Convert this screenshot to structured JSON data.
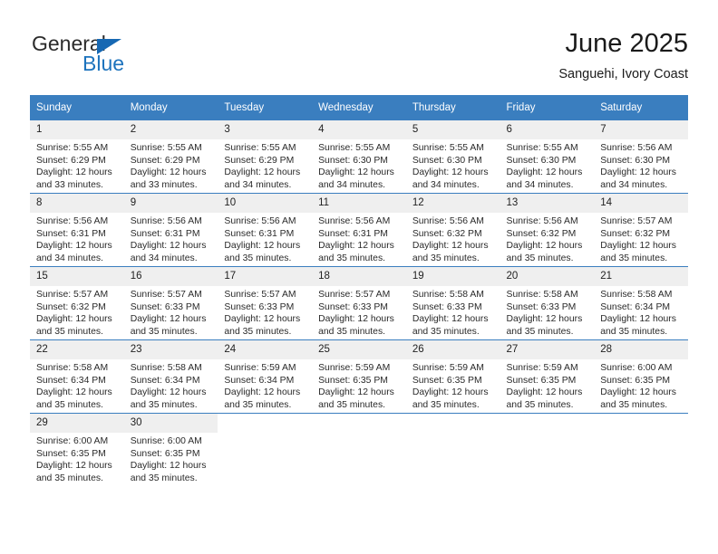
{
  "brand": {
    "name_top": "General",
    "name_bottom": "Blue",
    "triangle_icon": "blue-triangle-logo-icon",
    "color_blue": "#1d73bd",
    "color_dark": "#2b2b2b"
  },
  "header": {
    "month_title": "June 2025",
    "location": "Sanguehi, Ivory Coast"
  },
  "theme": {
    "header_blue": "#3a7ebf",
    "daynum_band": "#efefef",
    "separator": "#3a7ebf",
    "text": "#2a2a2a"
  },
  "weekdays": [
    "Sunday",
    "Monday",
    "Tuesday",
    "Wednesday",
    "Thursday",
    "Friday",
    "Saturday"
  ],
  "weeks": [
    [
      {
        "date": "1",
        "sunrise": "Sunrise: 5:55 AM",
        "sunset": "Sunset: 6:29 PM",
        "daylight": "Daylight: 12 hours and 33 minutes."
      },
      {
        "date": "2",
        "sunrise": "Sunrise: 5:55 AM",
        "sunset": "Sunset: 6:29 PM",
        "daylight": "Daylight: 12 hours and 33 minutes."
      },
      {
        "date": "3",
        "sunrise": "Sunrise: 5:55 AM",
        "sunset": "Sunset: 6:29 PM",
        "daylight": "Daylight: 12 hours and 34 minutes."
      },
      {
        "date": "4",
        "sunrise": "Sunrise: 5:55 AM",
        "sunset": "Sunset: 6:30 PM",
        "daylight": "Daylight: 12 hours and 34 minutes."
      },
      {
        "date": "5",
        "sunrise": "Sunrise: 5:55 AM",
        "sunset": "Sunset: 6:30 PM",
        "daylight": "Daylight: 12 hours and 34 minutes."
      },
      {
        "date": "6",
        "sunrise": "Sunrise: 5:55 AM",
        "sunset": "Sunset: 6:30 PM",
        "daylight": "Daylight: 12 hours and 34 minutes."
      },
      {
        "date": "7",
        "sunrise": "Sunrise: 5:56 AM",
        "sunset": "Sunset: 6:30 PM",
        "daylight": "Daylight: 12 hours and 34 minutes."
      }
    ],
    [
      {
        "date": "8",
        "sunrise": "Sunrise: 5:56 AM",
        "sunset": "Sunset: 6:31 PM",
        "daylight": "Daylight: 12 hours and 34 minutes."
      },
      {
        "date": "9",
        "sunrise": "Sunrise: 5:56 AM",
        "sunset": "Sunset: 6:31 PM",
        "daylight": "Daylight: 12 hours and 34 minutes."
      },
      {
        "date": "10",
        "sunrise": "Sunrise: 5:56 AM",
        "sunset": "Sunset: 6:31 PM",
        "daylight": "Daylight: 12 hours and 35 minutes."
      },
      {
        "date": "11",
        "sunrise": "Sunrise: 5:56 AM",
        "sunset": "Sunset: 6:31 PM",
        "daylight": "Daylight: 12 hours and 35 minutes."
      },
      {
        "date": "12",
        "sunrise": "Sunrise: 5:56 AM",
        "sunset": "Sunset: 6:32 PM",
        "daylight": "Daylight: 12 hours and 35 minutes."
      },
      {
        "date": "13",
        "sunrise": "Sunrise: 5:56 AM",
        "sunset": "Sunset: 6:32 PM",
        "daylight": "Daylight: 12 hours and 35 minutes."
      },
      {
        "date": "14",
        "sunrise": "Sunrise: 5:57 AM",
        "sunset": "Sunset: 6:32 PM",
        "daylight": "Daylight: 12 hours and 35 minutes."
      }
    ],
    [
      {
        "date": "15",
        "sunrise": "Sunrise: 5:57 AM",
        "sunset": "Sunset: 6:32 PM",
        "daylight": "Daylight: 12 hours and 35 minutes."
      },
      {
        "date": "16",
        "sunrise": "Sunrise: 5:57 AM",
        "sunset": "Sunset: 6:33 PM",
        "daylight": "Daylight: 12 hours and 35 minutes."
      },
      {
        "date": "17",
        "sunrise": "Sunrise: 5:57 AM",
        "sunset": "Sunset: 6:33 PM",
        "daylight": "Daylight: 12 hours and 35 minutes."
      },
      {
        "date": "18",
        "sunrise": "Sunrise: 5:57 AM",
        "sunset": "Sunset: 6:33 PM",
        "daylight": "Daylight: 12 hours and 35 minutes."
      },
      {
        "date": "19",
        "sunrise": "Sunrise: 5:58 AM",
        "sunset": "Sunset: 6:33 PM",
        "daylight": "Daylight: 12 hours and 35 minutes."
      },
      {
        "date": "20",
        "sunrise": "Sunrise: 5:58 AM",
        "sunset": "Sunset: 6:33 PM",
        "daylight": "Daylight: 12 hours and 35 minutes."
      },
      {
        "date": "21",
        "sunrise": "Sunrise: 5:58 AM",
        "sunset": "Sunset: 6:34 PM",
        "daylight": "Daylight: 12 hours and 35 minutes."
      }
    ],
    [
      {
        "date": "22",
        "sunrise": "Sunrise: 5:58 AM",
        "sunset": "Sunset: 6:34 PM",
        "daylight": "Daylight: 12 hours and 35 minutes."
      },
      {
        "date": "23",
        "sunrise": "Sunrise: 5:58 AM",
        "sunset": "Sunset: 6:34 PM",
        "daylight": "Daylight: 12 hours and 35 minutes."
      },
      {
        "date": "24",
        "sunrise": "Sunrise: 5:59 AM",
        "sunset": "Sunset: 6:34 PM",
        "daylight": "Daylight: 12 hours and 35 minutes."
      },
      {
        "date": "25",
        "sunrise": "Sunrise: 5:59 AM",
        "sunset": "Sunset: 6:35 PM",
        "daylight": "Daylight: 12 hours and 35 minutes."
      },
      {
        "date": "26",
        "sunrise": "Sunrise: 5:59 AM",
        "sunset": "Sunset: 6:35 PM",
        "daylight": "Daylight: 12 hours and 35 minutes."
      },
      {
        "date": "27",
        "sunrise": "Sunrise: 5:59 AM",
        "sunset": "Sunset: 6:35 PM",
        "daylight": "Daylight: 12 hours and 35 minutes."
      },
      {
        "date": "28",
        "sunrise": "Sunrise: 6:00 AM",
        "sunset": "Sunset: 6:35 PM",
        "daylight": "Daylight: 12 hours and 35 minutes."
      }
    ],
    [
      {
        "date": "29",
        "sunrise": "Sunrise: 6:00 AM",
        "sunset": "Sunset: 6:35 PM",
        "daylight": "Daylight: 12 hours and 35 minutes."
      },
      {
        "date": "30",
        "sunrise": "Sunrise: 6:00 AM",
        "sunset": "Sunset: 6:35 PM",
        "daylight": "Daylight: 12 hours and 35 minutes."
      },
      {
        "date": "",
        "sunrise": "",
        "sunset": "",
        "daylight": ""
      },
      {
        "date": "",
        "sunrise": "",
        "sunset": "",
        "daylight": ""
      },
      {
        "date": "",
        "sunrise": "",
        "sunset": "",
        "daylight": ""
      },
      {
        "date": "",
        "sunrise": "",
        "sunset": "",
        "daylight": ""
      },
      {
        "date": "",
        "sunrise": "",
        "sunset": "",
        "daylight": ""
      }
    ]
  ]
}
